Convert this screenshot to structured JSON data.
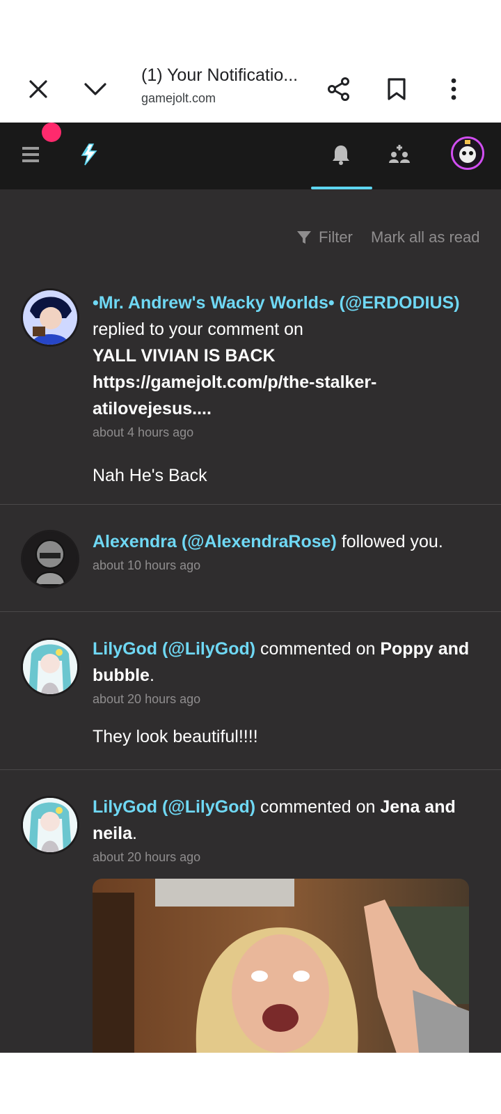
{
  "browser": {
    "title": "(1) Your Notificatio...",
    "url": "gamejolt.com"
  },
  "filter_label": "Filter",
  "mark_all_label": "Mark all as read",
  "notifications": [
    {
      "user": "•Mr. Andrew's Wacky Worlds• (@ERDODIUS)",
      "action": " replied to your comment on",
      "target": "YALL VIVIAN IS BACK https://gamejolt.com/p/the-stalker-atilovejesus....",
      "time": "about 4 hours ago",
      "quote": "Nah He's Back"
    },
    {
      "user": "Alexendra (@AlexendraRose)",
      "action": " followed you.",
      "time": "about 10 hours ago"
    },
    {
      "user": "LilyGod (@LilyGod)",
      "action": " commented on ",
      "target": "Poppy and bubble",
      "suffix": ".",
      "time": "about 20 hours ago",
      "quote": "They look beautiful!!!!"
    },
    {
      "user": "LilyGod (@LilyGod)",
      "action": " commented on ",
      "target": "Jena and neila",
      "suffix": ".",
      "time": "about 20 hours ago"
    }
  ],
  "colors": {
    "accent": "#6fd8f4",
    "notification_dot": "#ff2a6d",
    "background": "#2f2d2e",
    "nav_background": "#191919"
  }
}
